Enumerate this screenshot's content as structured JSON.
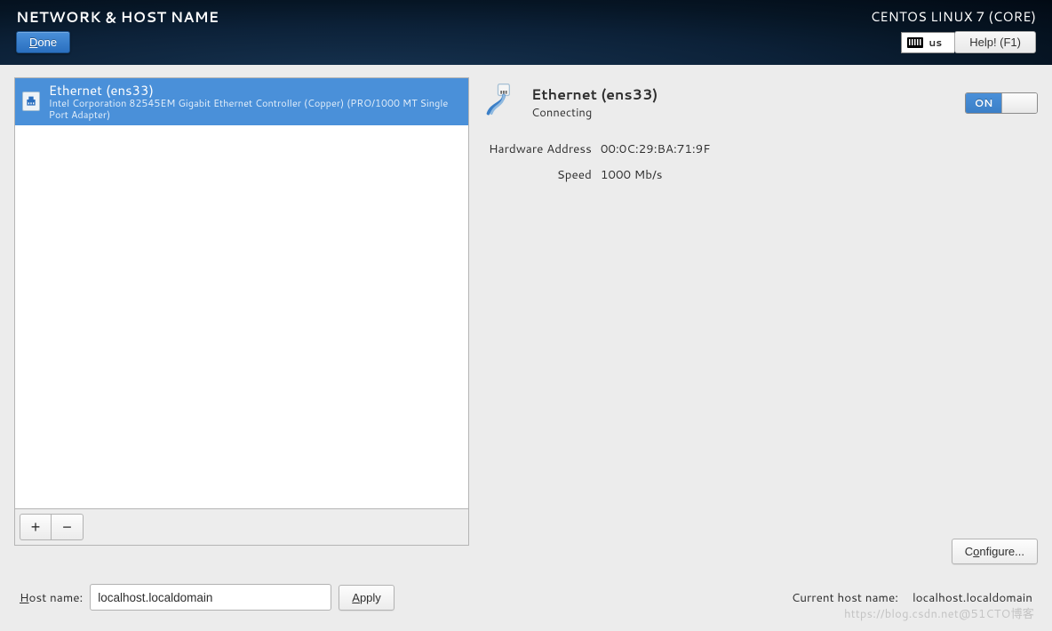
{
  "header": {
    "title": "NETWORK & HOST NAME",
    "distro": "CENTOS LINUX 7 (CORE)",
    "done_prefix": "D",
    "done_rest": "one",
    "kb_layout": "us",
    "help_label": "Help! (F1)"
  },
  "nic_list": {
    "items": [
      {
        "name": "Ethernet (ens33)",
        "sub": "Intel Corporation 82545EM Gigabit Ethernet Controller (Copper) (PRO/1000 MT Single Port Adapter)"
      }
    ],
    "add_label": "+",
    "remove_label": "−"
  },
  "detail": {
    "name": "Ethernet (ens33)",
    "state": "Connecting",
    "toggle_on_label": "ON",
    "hw_label": "Hardware Address",
    "hw_value": "00:0C:29:BA:71:9F",
    "speed_label": "Speed",
    "speed_value": "1000 Mb/s",
    "configure_prefix": "C",
    "configure_ul": "o",
    "configure_rest": "nfigure..."
  },
  "hostname": {
    "label_ul": "H",
    "label_rest": "ost name:",
    "value": "localhost.localdomain",
    "apply_ul": "A",
    "apply_rest": "pply",
    "current_label": "Current host name:",
    "current_value": "localhost.localdomain"
  },
  "watermark": "https://blog.csdn.net@51CTO博客"
}
